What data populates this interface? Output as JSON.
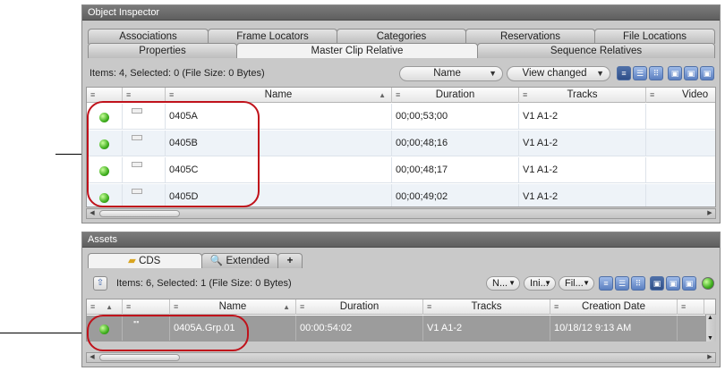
{
  "object_inspector": {
    "title": "Object Inspector",
    "tabs_back": [
      "Associations",
      "Frame Locators",
      "Categories",
      "Reservations",
      "File Locations"
    ],
    "tabs_front": [
      "Properties",
      "Master Clip Relative",
      "Sequence Relatives"
    ],
    "active_tab": "Master Clip Relative",
    "items_text": "Items: 4, Selected: 0 (File Size: 0 Bytes)",
    "sort_dropdown": "Name",
    "view_dropdown": "View changed",
    "columns": [
      "Name",
      "Duration",
      "Tracks",
      "Video"
    ],
    "rows": [
      {
        "name": "0405A",
        "duration": "00;00;53;00",
        "tracks": "V1 A1-2"
      },
      {
        "name": "0405B",
        "duration": "00;00;48;16",
        "tracks": "V1 A1-2"
      },
      {
        "name": "0405C",
        "duration": "00;00;48;17",
        "tracks": "V1 A1-2"
      },
      {
        "name": "0405D",
        "duration": "00;00;49;02",
        "tracks": "V1 A1-2"
      }
    ]
  },
  "assets": {
    "title": "Assets",
    "tabs": [
      "CDS",
      "Extended",
      "+"
    ],
    "items_text": "Items: 6, Selected: 1 (File Size: 0 Bytes)",
    "filters": [
      "N...",
      "Ini...",
      "Fil..."
    ],
    "columns": [
      "Name",
      "Duration",
      "Tracks",
      "Creation Date"
    ],
    "rows": [
      {
        "name": "0405A.Grp.01",
        "duration": "00:00:54:02",
        "tracks": "V1 A1-2",
        "creation_date": "10/18/12 9:13 AM"
      }
    ]
  },
  "colors": {
    "highlight": "#c0121b",
    "status_green": "#3fae1e",
    "selected_row": "#9c9c9c"
  },
  "icons": [
    "up-arrow-icon",
    "folder-icon",
    "magnifier-icon",
    "list-view-icon",
    "grid-view-icon",
    "status-dot-icon"
  ]
}
